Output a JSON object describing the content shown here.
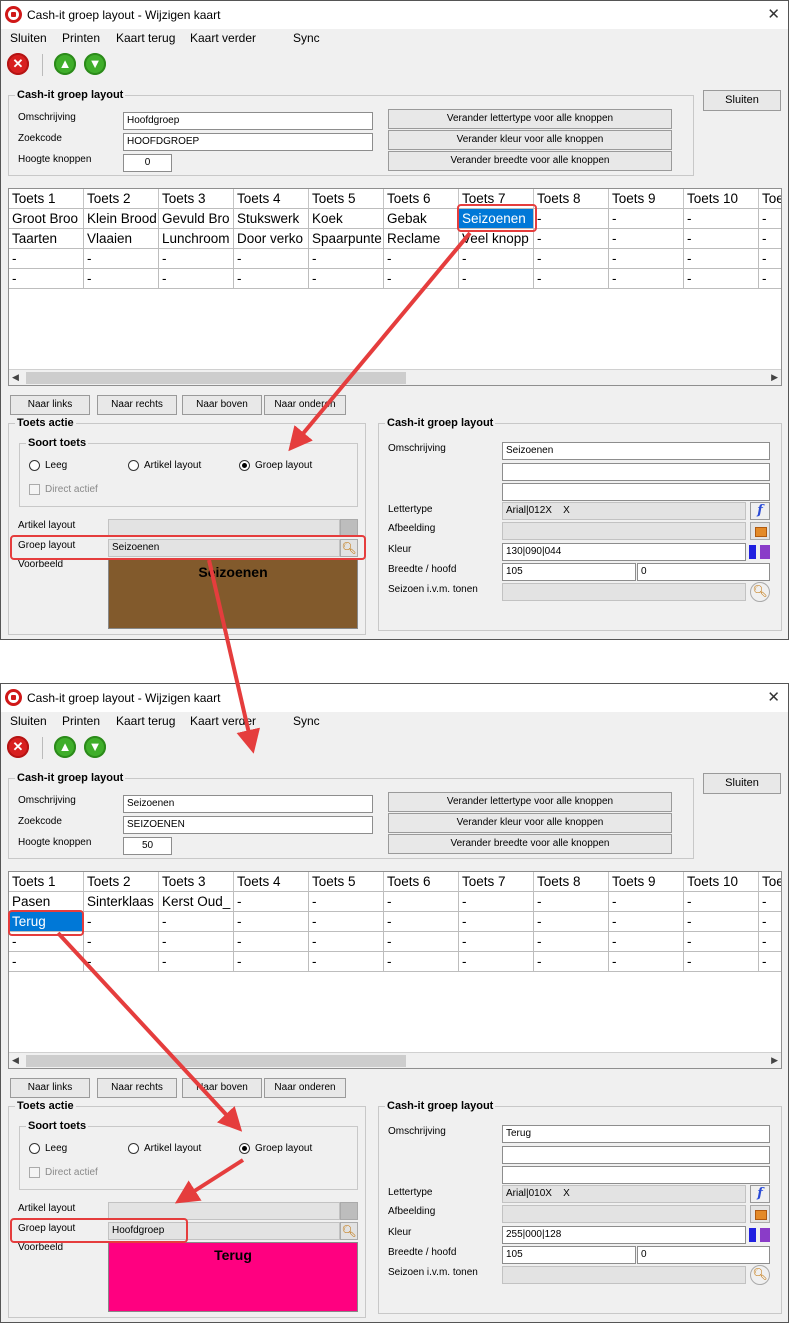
{
  "window_title": "Cash-it groep layout - Wijzigen kaart",
  "menu": [
    "Sluiten",
    "Printen",
    "Kaart terug",
    "Kaart verder",
    "Sync"
  ],
  "icons": [
    "close-icon",
    "arrow-up-icon",
    "arrow-down-icon"
  ],
  "sluiten_button": "Sluiten",
  "group_legend": "Cash-it groep layout",
  "labels": {
    "omschrijving": "Omschrijving",
    "zoekcode": "Zoekcode",
    "hoogte": "Hoogte knoppen"
  },
  "action_buttons": [
    "Verander lettertype voor alle knoppen",
    "Verander kleur voor alle knoppen",
    "Verander breedte voor alle knoppen"
  ],
  "nav_buttons": [
    "Naar links",
    "Naar rechts",
    "Naar boven",
    "Naar onderen"
  ],
  "columns": [
    "Toets 1",
    "Toets 2",
    "Toets 3",
    "Toets 4",
    "Toets 5",
    "Toets 6",
    "Toets 7",
    "Toets 8",
    "Toets 9",
    "Toets 10",
    "Toe"
  ],
  "toets_actie": {
    "legend": "Toets actie",
    "soort_legend": "Soort toets",
    "options": [
      "Leeg",
      "Artikel layout",
      "Groep layout"
    ],
    "direct_actief": "Direct actief",
    "artikel_layout_label": "Artikel layout",
    "groep_layout_label": "Groep layout",
    "voorbeeld_label": "Voorbeeld"
  },
  "detail_labels": {
    "legend": "Cash-it groep layout",
    "omschrijving": "Omschrijving",
    "lettertype": "Lettertype",
    "afbeelding": "Afbeelding",
    "kleur": "Kleur",
    "breedte": "Breedte / hoofd",
    "seizoen": "Seizoen i.v.m. tonen"
  },
  "screen1": {
    "omschrijving": "Hoofdgroep",
    "zoekcode": "HOOFDGROEP",
    "hoogte": "0",
    "rows": [
      [
        "Groot Broo",
        "Klein Brood",
        "Gevuld Bro",
        "Stukswerk",
        "Koek",
        "Gebak",
        "Seizoenen",
        "-",
        "-",
        "-",
        "-"
      ],
      [
        "Taarten",
        "Vlaaien",
        "Lunchroom",
        "Door verko",
        "Spaarpunte",
        "Reclame",
        "Veel knopp",
        "-",
        "-",
        "-",
        "-"
      ],
      [
        "-",
        "-",
        "-",
        "-",
        "-",
        "-",
        "-",
        "-",
        "-",
        "-",
        "-"
      ],
      [
        "-",
        "-",
        "-",
        "-",
        "-",
        "-",
        "-",
        "-",
        "-",
        "-",
        "-"
      ]
    ],
    "selected_row": 0,
    "selected_col": 6,
    "selected_option": 2,
    "groep_layout_value": "Seizoenen",
    "preview_text": "Seizoenen",
    "preview_color": "#825a2c",
    "detail": {
      "omschrijving": "Seizoenen",
      "lettertype": "Arial|012X    X",
      "kleur": "130|090|044",
      "breedte": "105",
      "hoofd": "0"
    }
  },
  "screen2": {
    "omschrijving": "Seizoenen",
    "zoekcode": "SEIZOENEN",
    "hoogte": "50",
    "rows": [
      [
        "Pasen",
        "Sinterklaas",
        "Kerst Oud_",
        "-",
        "-",
        "-",
        "-",
        "-",
        "-",
        "-",
        "-"
      ],
      [
        "Terug",
        "-",
        "-",
        "-",
        "-",
        "-",
        "-",
        "-",
        "-",
        "-",
        "-"
      ],
      [
        "-",
        "-",
        "-",
        "-",
        "-",
        "-",
        "-",
        "-",
        "-",
        "-",
        "-"
      ],
      [
        "-",
        "-",
        "-",
        "-",
        "-",
        "-",
        "-",
        "-",
        "-",
        "-",
        "-"
      ]
    ],
    "selected_row": 1,
    "selected_col": 0,
    "selected_option": 2,
    "groep_layout_value": "Hoofdgroep",
    "preview_text": "Terug",
    "preview_color": "#ff0080",
    "detail": {
      "omschrijving": "Terug",
      "lettertype": "Arial|010X    X",
      "kleur": "255|000|128",
      "breedte": "105",
      "hoofd": "0"
    }
  },
  "colors": {
    "selection": "#0078d7",
    "annotation": "#e53d3d",
    "close": "#d82020",
    "arrows": "#3fae2a"
  }
}
